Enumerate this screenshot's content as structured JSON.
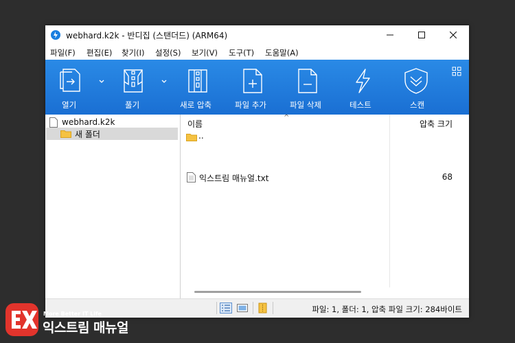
{
  "window": {
    "title": "webhard.k2k - 반디집 (스탠더드) (ARM64)"
  },
  "menu": [
    "파일(F)",
    "편집(E)",
    "찾기(I)",
    "설정(S)",
    "보기(V)",
    "도구(T)",
    "도움말(A)"
  ],
  "toolbar": {
    "open_label": "열기",
    "extract_label": "풀기",
    "new_archive_label": "새로 압축",
    "add_files_label": "파일 추가",
    "delete_files_label": "파일 삭제",
    "test_label": "테스트",
    "scan_label": "스캔"
  },
  "tree": {
    "root": "webhard.k2k",
    "child": "새 폴더"
  },
  "list": {
    "col_name": "이름",
    "col_size": "압축 크기",
    "rows": [
      {
        "name": "..",
        "size": "",
        "icon": "folder-icon"
      },
      {
        "name": "익스트림 매뉴얼.txt",
        "size": "68",
        "icon": "text-file-icon"
      }
    ]
  },
  "status": {
    "text": "파일: 1, 폴더: 1, 압축 파일 크기: 284바이트"
  },
  "brand": {
    "logo": "EX",
    "tagline": "More Better IT Life",
    "name": "익스트림 매뉴얼"
  },
  "colors": {
    "toolbar": "#1a7fe0",
    "selection": "#d9d9d9",
    "folder": "#f5c242",
    "brand": "#e2342c"
  }
}
